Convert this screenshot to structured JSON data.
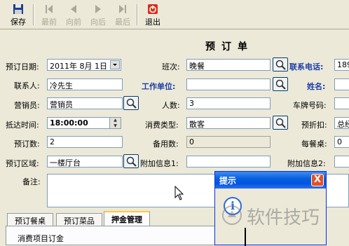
{
  "toolbar": {
    "save": "保存",
    "first": "最前",
    "prev": "向前",
    "next": "向后",
    "last": "最后",
    "exit": "退出"
  },
  "form": {
    "title": "预订单",
    "booking_date_label": "预订日期:",
    "booking_date": "2011年 8月 1日",
    "shift_label": "班次:",
    "shift": "晚餐",
    "phone_label": "联系电话:",
    "phone": "189",
    "contact_label": "联系人:",
    "contact": "冷先生",
    "company_label": "工作单位:",
    "company": "",
    "surname_label": "姓名:",
    "sales_label": "营销员:",
    "sales": "营销员",
    "people_label": "人数:",
    "people": "3",
    "plate_label": "车牌号码:",
    "arrival_label": "抵达时间:",
    "arrival": "18:00:00",
    "consume_type_label": "消费类型:",
    "consume_type": "散客",
    "discount_label": "预折扣:",
    "discount": "总经",
    "tables_label": "预订数:",
    "tables": "2",
    "spare_label": "备用数:",
    "spare": "0",
    "per_table_label": "每餐桌:",
    "per_table": "0",
    "area_label": "预订区域:",
    "area": "一楼厅台",
    "extra1_label": "附加信息1:",
    "extra2_label": "附加信息2:",
    "note_label": "备注:"
  },
  "tabs": [
    "预订餐桌",
    "预订菜品",
    "押金管理"
  ],
  "tab_panel": {
    "caption": "消费项目订金"
  },
  "dialog": {
    "title": "提示",
    "close": "X",
    "icon_glyph": "i"
  },
  "watermark": "软件技巧",
  "colors": {
    "label_blue": "#1c3da8",
    "titlebar_blue": "#0054e3",
    "close_red": "#e0512b"
  }
}
